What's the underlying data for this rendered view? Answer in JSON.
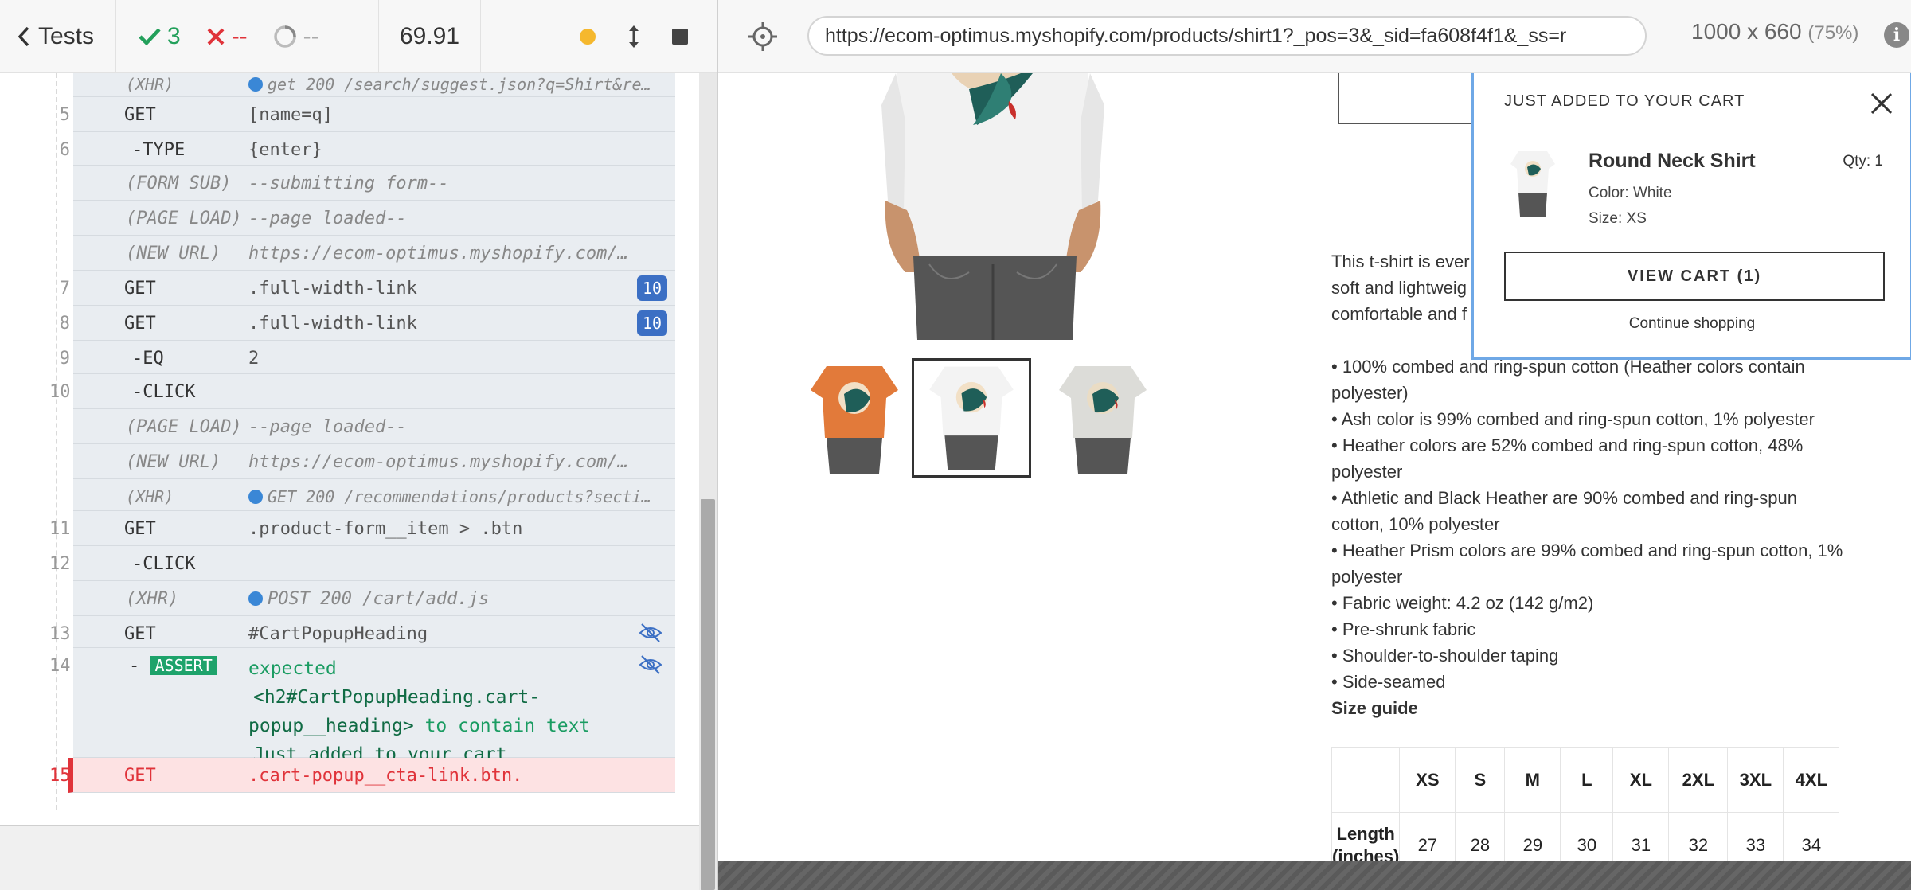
{
  "header": {
    "back_label": "Tests",
    "passed": "3",
    "failed": "--",
    "pending": "--",
    "duration": "69.91"
  },
  "log": {
    "partial_top": {
      "name": "(XHR)",
      "msg": "get 200 /search/suggest.json?q=Shirt&re…"
    },
    "rows": [
      {
        "num": "5",
        "name": "GET",
        "msg": "[name=q]"
      },
      {
        "num": "6",
        "name": "-TYPE",
        "msg": "{enter}"
      },
      {
        "name": "(FORM SUB)",
        "msg": "--submitting form--"
      },
      {
        "name": "(PAGE LOAD)",
        "msg": "--page loaded--"
      },
      {
        "name": "(NEW URL)",
        "msg": "https://ecom-optimus.myshopify.com/…"
      },
      {
        "num": "7",
        "name": "GET",
        "msg": ".full-width-link",
        "badge": "10"
      },
      {
        "num": "8",
        "name": "GET",
        "msg": ".full-width-link",
        "badge": "10"
      },
      {
        "num": "9",
        "name": "-EQ",
        "msg": "2"
      },
      {
        "num": "10",
        "name": "-CLICK",
        "msg": ""
      },
      {
        "name": "(PAGE LOAD)",
        "msg": "--page loaded--"
      },
      {
        "name": "(NEW URL)",
        "msg": "https://ecom-optimus.myshopify.com/…"
      },
      {
        "name": "(XHR)",
        "msg": "GET 200 /recommendations/products?secti…"
      },
      {
        "num": "11",
        "name": "GET",
        "msg": ".product-form__item > .btn"
      },
      {
        "num": "12",
        "name": "-CLICK",
        "msg": ""
      },
      {
        "name": "(XHR)",
        "msg": "POST 200 /cart/add.js"
      },
      {
        "num": "13",
        "name": "GET",
        "msg": "#CartPopupHeading"
      }
    ],
    "assert": {
      "num": "14",
      "prefix": "-",
      "tag": "ASSERT",
      "line1": "expected",
      "line2": "<h2#CartPopupHeading.cart-",
      "line3a": "popup__heading>",
      "line3b": " to contain text",
      "line4": "Just added to your cart"
    },
    "failed_row": {
      "num": "15",
      "name": "GET",
      "msg": ".cart-popup__cta-link.btn."
    }
  },
  "aut": {
    "url": "https://ecom-optimus.myshopify.com/products/shirt1?_pos=3&_sid=fa608f4f1&_ss=r",
    "viewport": "1000 x 660",
    "scale": "(75%)",
    "description_lines": [
      "This t-shirt is ever",
      "soft and lightweig",
      "comfortable and f"
    ],
    "bullets": [
      "• 100% combed and ring-spun cotton (Heather colors contain polyester)",
      "• Ash color is 99% combed and ring-spun cotton, 1% polyester",
      "• Heather colors are 52% combed and ring-spun cotton, 48% polyester",
      "• Athletic and Black Heather are 90% combed and ring-spun cotton, 10% polyester",
      "• Heather Prism colors are 99% combed and ring-spun cotton, 1% polyester",
      "• Fabric weight: 4.2 oz (142 g/m2)",
      "• Pre-shrunk fabric",
      "• Shoulder-to-shoulder taping",
      "• Side-seamed"
    ],
    "size_guide_title": "Size guide",
    "size_table": {
      "headers": [
        "",
        "XS",
        "S",
        "M",
        "L",
        "XL",
        "2XL",
        "3XL",
        "4XL"
      ],
      "row_label": "Length (inches)",
      "row": [
        "27",
        "28",
        "29",
        "30",
        "31",
        "32",
        "33",
        "34"
      ]
    },
    "cart_popup": {
      "heading": "Just added to your cart",
      "product": "Round Neck Shirt",
      "qty": "Qty: 1",
      "color": "Color: White",
      "size": "Size: XS",
      "view_cart": "VIEW CART (1)",
      "continue": "Continue shopping"
    }
  },
  "colors": {
    "pass": "#23a05b",
    "fail": "#e0333a",
    "badge": "#3b6fc4",
    "assert": "#1ea36b",
    "popup_border": "#6fa8e6"
  }
}
